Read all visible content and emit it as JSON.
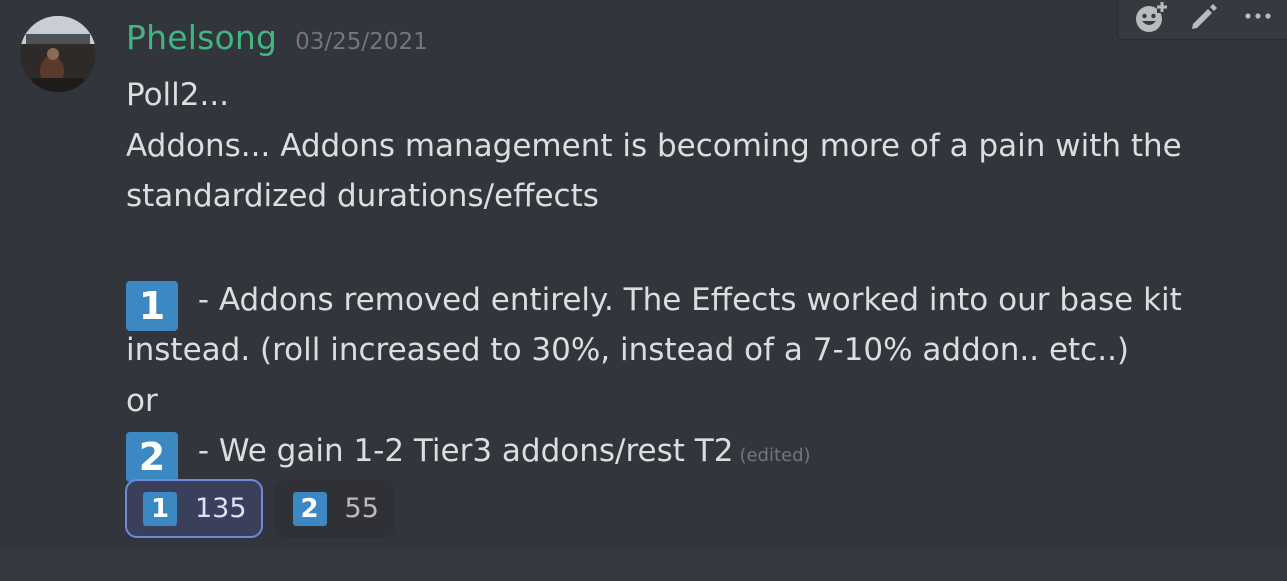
{
  "message": {
    "username": "Phelsong",
    "timestamp": "03/25/2021",
    "lines": [
      "Poll2...",
      "Addons... Addons management is becoming more of a pain with the",
      "standardized durations/effects"
    ],
    "option1": {
      "emoji": "1",
      "text_line1": " - Addons removed entirely. The Effects worked into our base kit",
      "text_line2": "instead. (roll increased to 30%, instead of a 7-10% addon.. etc..)"
    },
    "separator": "or",
    "option2": {
      "emoji": "2",
      "text": " - We gain 1-2 Tier3 addons/rest T2"
    },
    "edited_label": "(edited)"
  },
  "reactions": [
    {
      "emoji": "1",
      "count": "135",
      "active": true
    },
    {
      "emoji": "2",
      "count": "55",
      "active": false
    }
  ],
  "toolbar": {
    "icons": [
      "add-reaction-icon",
      "edit-icon",
      "more-icon"
    ]
  },
  "colors": {
    "background": "#36393f",
    "username": "#43b581",
    "keycap": "#3b88c3",
    "reaction_active_border": "#7289da"
  }
}
